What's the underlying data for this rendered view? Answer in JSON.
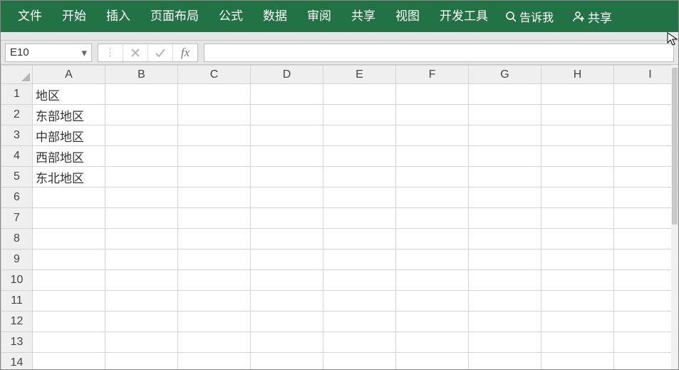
{
  "ribbon": {
    "tabs": [
      "文件",
      "开始",
      "插入",
      "页面布局",
      "公式",
      "数据",
      "审阅",
      "共享",
      "视图",
      "开发工具"
    ],
    "tellme": "告诉我",
    "share": "共享"
  },
  "formulaBar": {
    "nameBox": "E10",
    "fxLabel": "fx",
    "formulaValue": ""
  },
  "columns": [
    "A",
    "B",
    "C",
    "D",
    "E",
    "F",
    "G",
    "H",
    "I"
  ],
  "rowCount": 14,
  "cells": {
    "A1": "地区",
    "A2": "东部地区",
    "A3": "中部地区",
    "A4": "西部地区",
    "A5": "东北地区"
  }
}
